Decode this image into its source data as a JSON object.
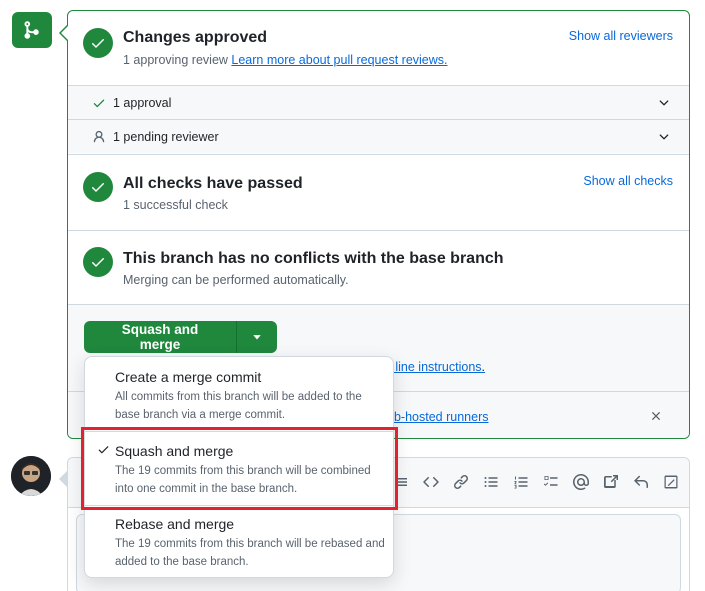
{
  "approval": {
    "title": "Changes approved",
    "subtitle": "1 approving review",
    "learn_link": "Learn more about pull request reviews.",
    "show_reviewers": "Show all reviewers"
  },
  "rows": {
    "approvals": "1 approval",
    "pending": "1 pending reviewer"
  },
  "checks": {
    "title": "All checks have passed",
    "subtitle": "1 successful check",
    "show_checks": "Show all checks"
  },
  "conflicts": {
    "title": "This branch has no conflicts with the base branch",
    "subtitle": "Merging can be performed automatically."
  },
  "merge": {
    "button_label": "Squash and merge",
    "command_line_link": "nd line instructions",
    "command_line_suffix": ".",
    "runners_link": "Hub-hosted runners"
  },
  "menu": {
    "items": [
      {
        "title": "Create a merge commit",
        "description": "All commits from this branch will be added to the base branch via a merge commit.",
        "selected": false
      },
      {
        "title": "Squash and merge",
        "description": "The 19 commits from this branch will be combined into one commit in the base branch.",
        "selected": true
      },
      {
        "title": "Rebase and merge",
        "description": "The 19 commits from this branch will be rebased and added to the base branch.",
        "selected": false
      }
    ]
  },
  "toolbar_icons": [
    "list-icon",
    "code-icon",
    "link-icon",
    "unordered-list-icon",
    "ordered-list-icon",
    "task-list-icon",
    "mention-icon",
    "cross-reference-icon",
    "reply-icon",
    "fullscreen-icon"
  ],
  "colors": {
    "success": "#1f883d",
    "link": "#0969da",
    "highlight": "#e0232e"
  }
}
